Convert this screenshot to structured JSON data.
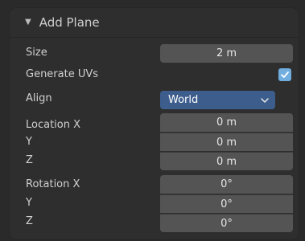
{
  "panel": {
    "title": "Add Plane",
    "collapse_icon": "triangle-down-icon"
  },
  "size": {
    "label": "Size",
    "value": "2 m"
  },
  "generate_uvs": {
    "label": "Generate UVs",
    "checked": true
  },
  "align": {
    "label": "Align",
    "value": "World",
    "icon": "chevron-down-icon"
  },
  "location": {
    "x_label": "Location X",
    "y_label": "Y",
    "z_label": "Z",
    "x": "0 m",
    "y": "0 m",
    "z": "0 m"
  },
  "rotation": {
    "x_label": "Rotation X",
    "y_label": "Y",
    "z_label": "Z",
    "x": "0°",
    "y": "0°",
    "z": "0°"
  },
  "colors": {
    "panel_bg": "#2e2e2e",
    "field_bg": "#545454",
    "dropdown_bg": "#3d5e8d",
    "checkbox_accent": "#71aee0"
  }
}
